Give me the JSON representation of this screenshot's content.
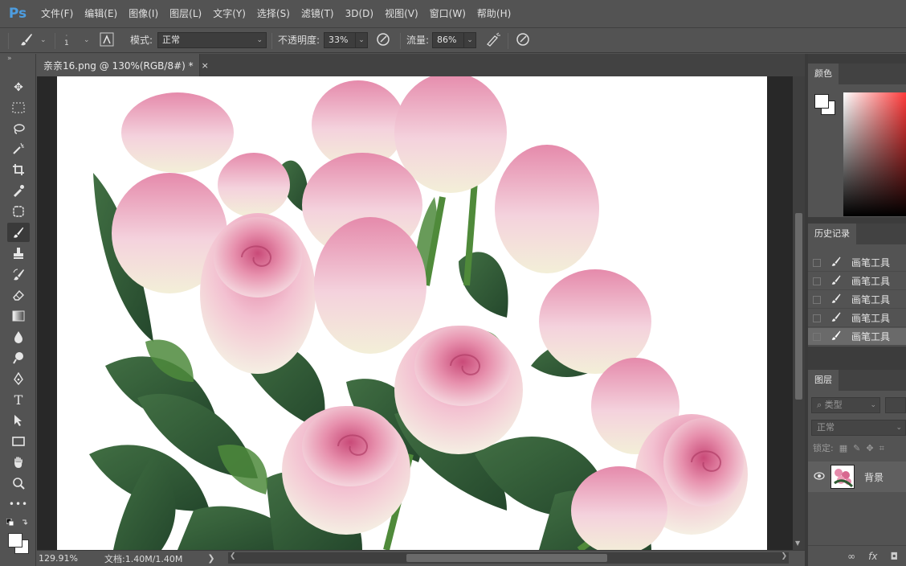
{
  "app": {
    "logo": "Ps"
  },
  "menu": [
    "文件(F)",
    "编辑(E)",
    "图像(I)",
    "图层(L)",
    "文字(Y)",
    "选择(S)",
    "滤镜(T)",
    "3D(D)",
    "视图(V)",
    "窗口(W)",
    "帮助(H)"
  ],
  "options": {
    "brush_size": "1",
    "mode_label": "模式:",
    "mode_value": "正常",
    "opacity_label": "不透明度:",
    "opacity_value": "33%",
    "flow_label": "流量:",
    "flow_value": "86%"
  },
  "document": {
    "tab_title": "亲亲16.png @ 130%(RGB/8#) *",
    "close_glyph": "×"
  },
  "status": {
    "zoom": "129.91%",
    "doc_info": "文档:1.40M/1.40M",
    "arrow": "❯"
  },
  "panels": {
    "color": {
      "title": "颜色"
    },
    "history": {
      "title": "历史记录",
      "items": [
        "画笔工具",
        "画笔工具",
        "画笔工具",
        "画笔工具",
        "画笔工具"
      ]
    },
    "layers": {
      "title": "图层",
      "filter": "类型",
      "blend": "正常",
      "lock_label": "锁定:",
      "layer_name": "背景",
      "bottom_icons": [
        "∞",
        "fx",
        "◘"
      ]
    }
  },
  "colors": {
    "foreground": "#ffffff",
    "background": "#ffffff",
    "accent": "#4d9de0"
  }
}
